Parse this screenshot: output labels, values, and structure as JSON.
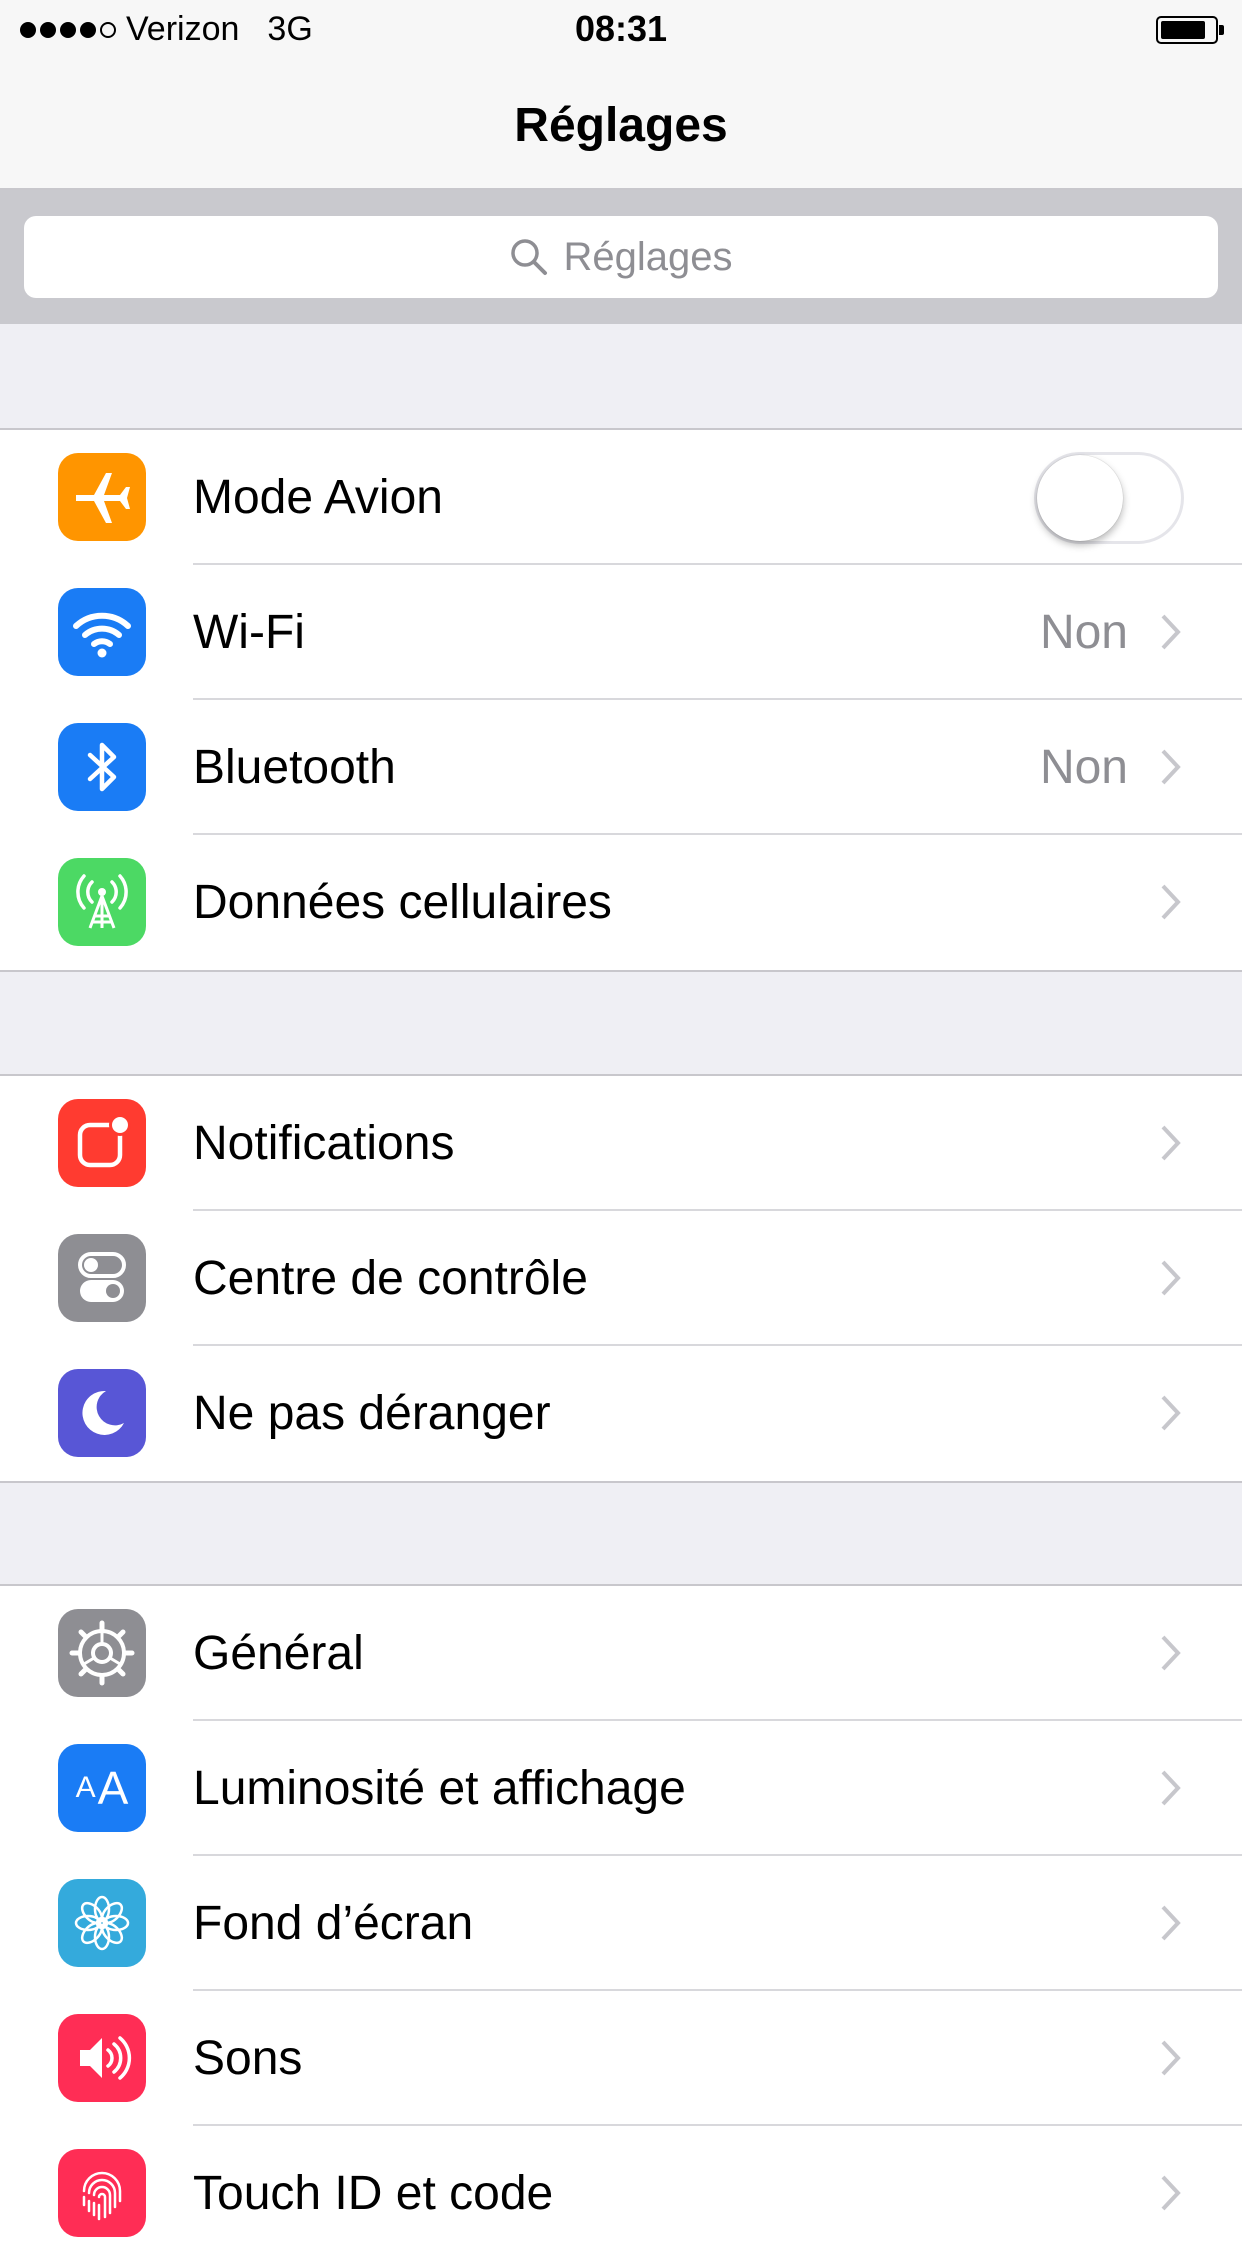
{
  "status_bar": {
    "carrier": "Verizon",
    "network": "3G",
    "time": "08:31",
    "signal_bars": 4,
    "signal_max": 5
  },
  "nav": {
    "title": "Réglages"
  },
  "search": {
    "placeholder": "Réglages"
  },
  "colors": {
    "orange": "#ff9500",
    "blue": "#1a7cf5",
    "green": "#4cd964",
    "red": "#ff3b30",
    "gray": "#8e8e93",
    "purple": "#5856d6",
    "lightblue": "#34aadc",
    "pink": "#ff2d55"
  },
  "groups": [
    {
      "items": [
        {
          "label": "Mode Avion",
          "icon": "airplane-icon",
          "toggle_on": false
        },
        {
          "label": "Wi-Fi",
          "icon": "wifi-icon",
          "value": "Non"
        },
        {
          "label": "Bluetooth",
          "icon": "bluetooth-icon",
          "value": "Non"
        },
        {
          "label": "Données cellulaires",
          "icon": "cellular-antenna-icon"
        }
      ]
    },
    {
      "items": [
        {
          "label": "Notifications",
          "icon": "notifications-icon"
        },
        {
          "label": "Centre de contrôle",
          "icon": "control-center-icon"
        },
        {
          "label": "Ne pas déranger",
          "icon": "moon-icon"
        }
      ]
    },
    {
      "items": [
        {
          "label": "Général",
          "icon": "gear-icon"
        },
        {
          "label": "Luminosité et affichage",
          "icon": "text-size-icon",
          "icon_text": "AA"
        },
        {
          "label": "Fond d’écran",
          "icon": "flower-icon"
        },
        {
          "label": "Sons",
          "icon": "speaker-icon"
        },
        {
          "label": "Touch ID et code",
          "icon": "fingerprint-icon"
        }
      ]
    }
  ]
}
